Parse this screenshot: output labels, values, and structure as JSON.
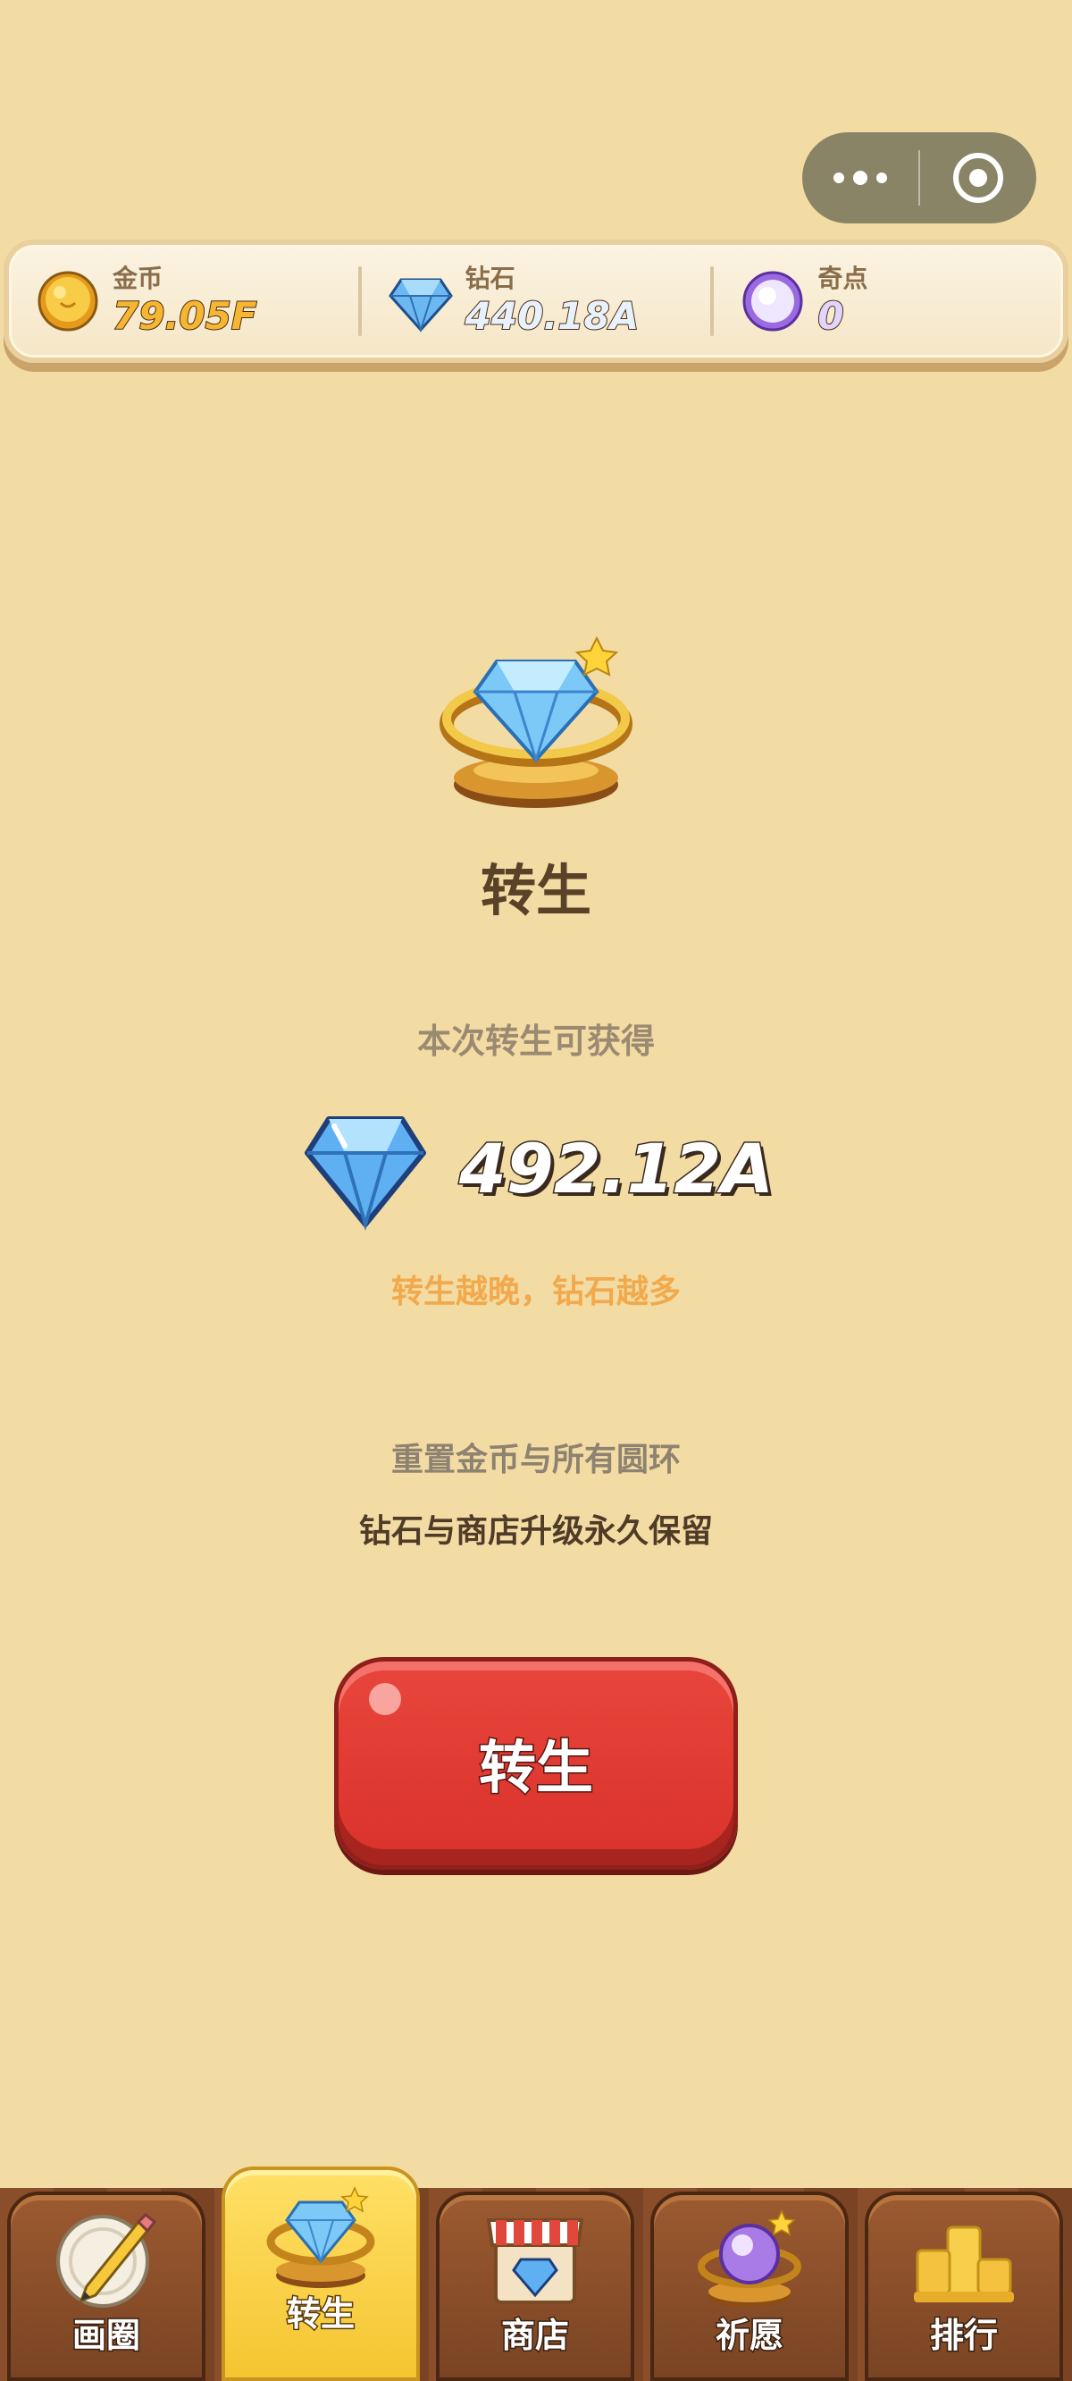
{
  "capsule": {
    "more_icon": "more-dots-icon",
    "close_icon": "target-circle-icon"
  },
  "resources": [
    {
      "label": "金币",
      "value": "79.05F",
      "icon": "gold-coin-icon"
    },
    {
      "label": "钻石",
      "value": "440.18A",
      "icon": "diamond-icon"
    },
    {
      "label": "奇点",
      "value": "0",
      "icon": "singularity-orb-icon"
    }
  ],
  "main": {
    "title": "转生",
    "gain_label": "本次转生可获得",
    "gain_value": "492.12A",
    "hint": "转生越晚，钻石越多",
    "info_reset": "重置金币与所有圆环",
    "info_keep": "钻石与商店升级永久保留",
    "button_label": "转生"
  },
  "tabs": [
    {
      "label": "画圈",
      "icon": "pencil-circle-icon",
      "active": false
    },
    {
      "label": "转生",
      "icon": "diamond-ring-icon",
      "active": true
    },
    {
      "label": "商店",
      "icon": "shop-icon",
      "active": false
    },
    {
      "label": "祈愿",
      "icon": "wish-orb-icon",
      "active": false
    },
    {
      "label": "排行",
      "icon": "podium-icon",
      "active": false
    }
  ],
  "colors": {
    "background": "#f3dca4",
    "button_red": "#d9322a",
    "hint_orange": "#f2a94c",
    "tab_active": "#f5c531"
  }
}
